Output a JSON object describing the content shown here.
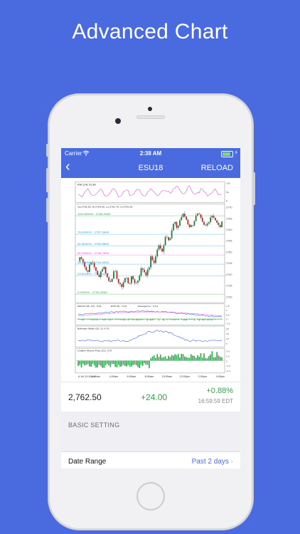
{
  "headline": "Advanced Chart",
  "status": {
    "carrier": "Carrier",
    "time": "2:38 AM"
  },
  "nav": {
    "title": "ESU18",
    "reload": "RELOAD"
  },
  "colors": {
    "brand": "#4a6be0",
    "up": "#2aa84a",
    "down": "#c0392b"
  },
  "indicators": {
    "rsi": {
      "label": "RSI (14): 51.80",
      "ticks": [
        "100",
        "50",
        "0"
      ]
    },
    "price": {
      "label": "Op:2762.50, Hi:2763.00, Lo:2762.75, Cl:2762.50",
      "fib": [
        {
          "label": "100.0000% : 2766.2500",
          "level": 2766.25,
          "color": "#2aa84a"
        },
        {
          "label": "76.4000% : 2757.9900",
          "level": 2757.99,
          "color": "#1f9ed8"
        },
        {
          "label": "61.8000% : 2752.8800",
          "level": 2752.88,
          "color": "#1f9ed8"
        },
        {
          "label": "50.0000% : 2748.7500",
          "level": 2748.75,
          "color": "#e04ee0"
        },
        {
          "label": "38.2000% : 2744.6200",
          "level": 2744.62,
          "color": "#1f9ed8"
        },
        {
          "label": "23.6000% : 2739.5100",
          "level": 2739.51,
          "color": "#1f9ed8"
        },
        {
          "label": "0.0000% : 2731.2500",
          "level": 2731.25,
          "color": "#2aa84a"
        }
      ],
      "ticks": [
        "2770",
        "2765",
        "2760",
        "2755",
        "2750",
        "2745",
        "2740",
        "2735",
        "2730"
      ]
    },
    "macd": {
      "label1": "MACD (26, 12) : 0.01",
      "label2": "EXP (9) : 0.01",
      "label3": "Divergence : 0.01",
      "ticks": [
        "1.5",
        "1",
        "0.5",
        "0",
        "-0.5"
      ]
    },
    "bollinger": {
      "label": "Bollinger Width (20, 2): 6.76",
      "ticks": [
        "20",
        "15",
        "10",
        "5"
      ]
    },
    "cmf": {
      "label": "Chaikin Money Flow (21): 0.07",
      "ticks": [
        "0.4",
        "0.2",
        "0",
        "-0.2",
        "-0.4"
      ]
    }
  },
  "xaxis": [
    "6 Jul 12:00am",
    "2:00am",
    "4:00am",
    "6:00am",
    "8:00am",
    "10:00am",
    "12:00pm",
    "2:00pm",
    "4:00pm"
  ],
  "quote": {
    "price": "2,762.50",
    "change": "+24.00",
    "percent": "+0.88%",
    "time": "16:59:59 EDT"
  },
  "settings": {
    "section": "BASIC SETTING",
    "rows": [
      {
        "label": "Date Range",
        "value": "Past 2 days"
      }
    ]
  }
}
